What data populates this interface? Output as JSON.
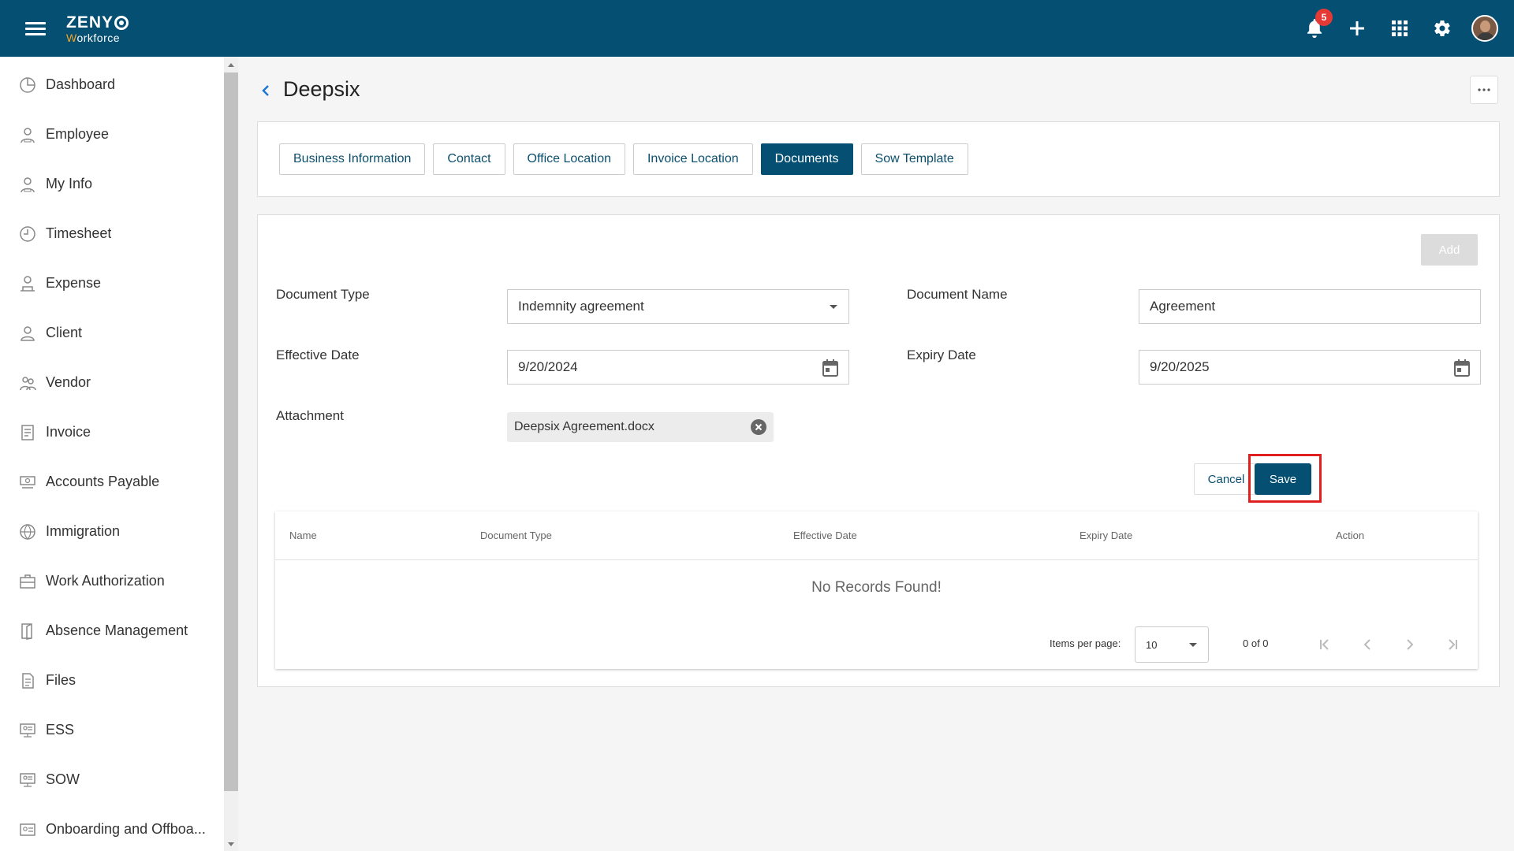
{
  "header": {
    "logo_main": "ZENY",
    "logo_sub_w": "W",
    "logo_sub_rest": "orkforce",
    "notification_count": "5",
    "icons": [
      "menu-icon",
      "bell-icon",
      "plus-icon",
      "apps-grid-icon",
      "gear-icon",
      "avatar"
    ]
  },
  "sidebar": {
    "items": [
      {
        "label": "Dashboard",
        "icon": "dashboard-icon"
      },
      {
        "label": "Employee",
        "icon": "employee-icon"
      },
      {
        "label": "My Info",
        "icon": "my-info-icon"
      },
      {
        "label": "Timesheet",
        "icon": "clock-icon"
      },
      {
        "label": "Expense",
        "icon": "expense-icon"
      },
      {
        "label": "Client",
        "icon": "client-icon"
      },
      {
        "label": "Vendor",
        "icon": "vendor-icon"
      },
      {
        "label": "Invoice",
        "icon": "invoice-icon"
      },
      {
        "label": "Accounts Payable",
        "icon": "accounts-payable-icon"
      },
      {
        "label": "Immigration",
        "icon": "globe-icon"
      },
      {
        "label": "Work Authorization",
        "icon": "briefcase-icon"
      },
      {
        "label": "Absence Management",
        "icon": "door-icon"
      },
      {
        "label": "Files",
        "icon": "file-icon"
      },
      {
        "label": "ESS",
        "icon": "ess-icon"
      },
      {
        "label": "SOW",
        "icon": "sow-icon"
      },
      {
        "label": "Onboarding and Offboa...",
        "icon": "id-card-icon"
      }
    ]
  },
  "page": {
    "title": "Deepsix"
  },
  "tabs": [
    {
      "label": "Business Information",
      "active": false
    },
    {
      "label": "Contact",
      "active": false
    },
    {
      "label": "Office Location",
      "active": false
    },
    {
      "label": "Invoice Location",
      "active": false
    },
    {
      "label": "Documents",
      "active": true
    },
    {
      "label": "Sow Template",
      "active": false
    }
  ],
  "form": {
    "add_label": "Add",
    "document_type_label": "Document Type",
    "document_type_value": "Indemnity agreement",
    "document_name_label": "Document Name",
    "document_name_value": "Agreement",
    "effective_date_label": "Effective Date",
    "effective_date_value": "9/20/2024",
    "expiry_date_label": "Expiry Date",
    "expiry_date_value": "9/20/2025",
    "attachment_label": "Attachment",
    "attachment_file": "Deepsix Agreement.docx",
    "cancel_label": "Cancel",
    "save_label": "Save"
  },
  "table": {
    "columns": [
      "Name",
      "Document Type",
      "Effective Date",
      "Expiry Date",
      "Action"
    ],
    "empty_text": "No Records Found!",
    "items_per_page_label": "Items per page:",
    "items_per_page_value": "10",
    "range_text": "0 of 0"
  },
  "colors": {
    "primary": "#054f73",
    "badge": "#e53935",
    "highlight": "#e02020"
  }
}
